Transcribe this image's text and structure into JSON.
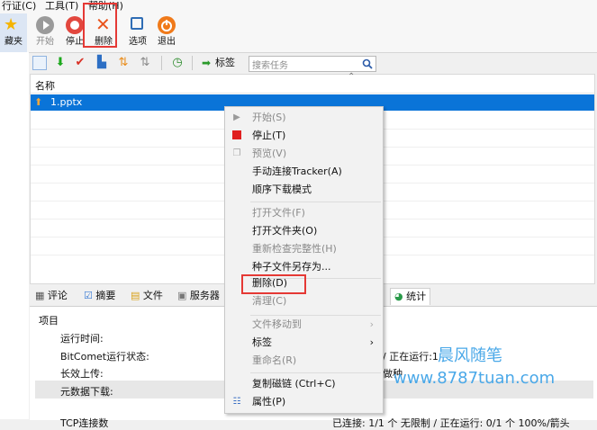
{
  "menubar": {
    "items": [
      "行证(C)",
      "工具(T)",
      "帮助(H)"
    ]
  },
  "toolbar": {
    "left_label": "藏夹",
    "start": "开始",
    "stop": "停止",
    "delete": "删除",
    "options": "选项",
    "exit": "退出"
  },
  "toolbar2": {
    "tag_label": "标签",
    "search_placeholder": "搜索任务"
  },
  "list": {
    "col_name": "名称",
    "rows": [
      "1.pptx"
    ]
  },
  "tabs": [
    "评论",
    "摘要",
    "文件",
    "服务器",
    "统计"
  ],
  "bottom": {
    "header": "项目",
    "rows": [
      "运行时间:",
      "BitComet运行状态:",
      "长效上传:",
      "元数据下载:"
    ],
    "right_fragment_1": "/ 正在运行:1",
    "right_fragment_2": "做种",
    "cut_row": "TCP连接数",
    "cut_right": "已连接: 1/1 个 无限制 / 正在运行: 0/1 个 100%/箭头"
  },
  "context_menu": [
    {
      "label": "开始(S)",
      "enabled": false,
      "icon": "play-icon"
    },
    {
      "label": "停止(T)",
      "enabled": true,
      "icon": "stop-icon"
    },
    {
      "label": "预览(V)",
      "enabled": false,
      "icon": "preview-icon"
    },
    {
      "label": "手动连接Tracker(A)",
      "enabled": true
    },
    {
      "label": "顺序下载模式",
      "enabled": true
    },
    {
      "sep": true
    },
    {
      "label": "打开文件(F)",
      "enabled": false
    },
    {
      "label": "打开文件夹(O)",
      "enabled": true
    },
    {
      "label": "重新检查完整性(H)",
      "enabled": false
    },
    {
      "label": "种子文件另存为...",
      "enabled": true
    },
    {
      "sep": true
    },
    {
      "label": "删除(D)",
      "enabled": true
    },
    {
      "label": "清理(C)",
      "enabled": false
    },
    {
      "sep": true
    },
    {
      "label": "文件移动到",
      "enabled": false,
      "submenu": true
    },
    {
      "label": "标签",
      "enabled": true,
      "submenu": true
    },
    {
      "label": "重命名(R)",
      "enabled": false
    },
    {
      "sep": true
    },
    {
      "label": "复制磁链 (Ctrl+C)",
      "enabled": true
    },
    {
      "label": "属性(P)",
      "enabled": true,
      "icon": "properties-icon"
    }
  ],
  "watermark": {
    "line1": "晨风随笔",
    "line2": "www.8787tuan.com"
  },
  "colors": {
    "selection": "#0a74d8",
    "highlight_box": "#e53935",
    "watermark": "#4aa8e8"
  }
}
